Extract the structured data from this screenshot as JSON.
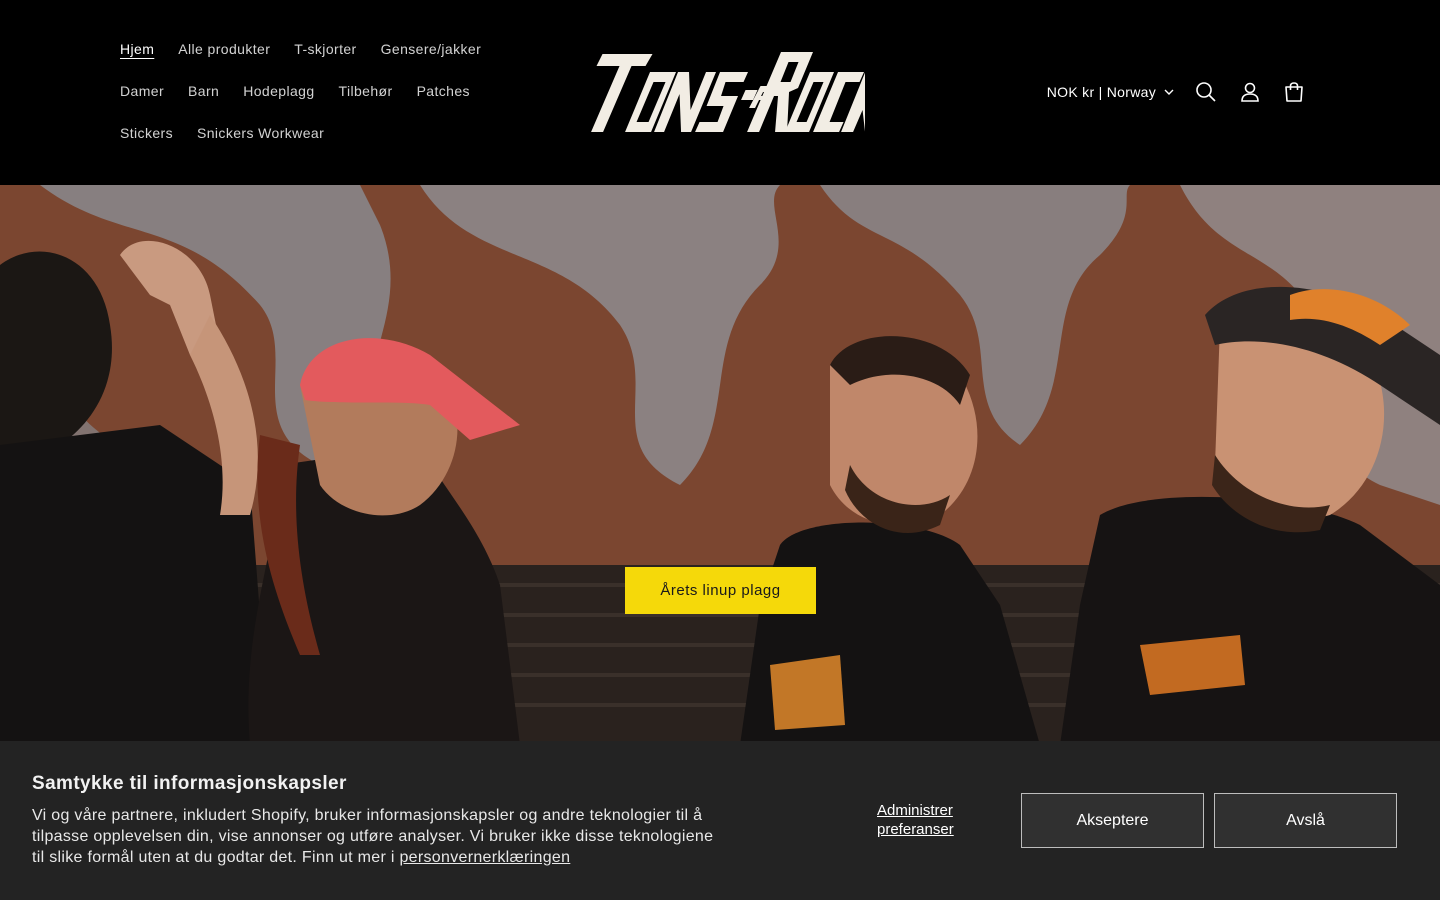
{
  "header": {
    "nav_rows": [
      [
        {
          "label": "Hjem",
          "active": true
        },
        {
          "label": "Alle produkter"
        },
        {
          "label": "T-skjorter"
        },
        {
          "label": "Gensere/jakker"
        }
      ],
      [
        {
          "label": "Damer"
        },
        {
          "label": "Barn"
        },
        {
          "label": "Hodeplagg"
        },
        {
          "label": "Tilbehør"
        },
        {
          "label": "Patches"
        }
      ],
      [
        {
          "label": "Stickers"
        },
        {
          "label": "Snickers Workwear"
        }
      ]
    ],
    "logo_text": "TONS OF ROCK",
    "locale_label": "NOK kr | Norway",
    "icons": [
      "search-icon",
      "account-icon",
      "cart-icon"
    ]
  },
  "hero": {
    "cta_label": "Årets linup plagg",
    "cta_color": "#f5d90a"
  },
  "cookie_banner": {
    "title": "Samtykke til informasjonskapsler",
    "text_line1": "Vi og våre partnere, inkludert Shopify, bruker informasjonskapsler og andre teknologier til å",
    "text_line2": "tilpasse opplevelsen din, vise annonser og utføre analyser. Vi bruker ikke disse teknologiene",
    "text_line3_prefix": "til slike formål uten at du godtar det. Finn ut mer i ",
    "privacy_link": "personvernerklæringen",
    "manage_line1": "Administrer",
    "manage_line2": "preferanser",
    "accept_label": "Akseptere",
    "decline_label": "Avslå"
  },
  "colors": {
    "header_bg": "#000000",
    "banner_bg": "#232323",
    "cta_yellow": "#f5d90a"
  }
}
